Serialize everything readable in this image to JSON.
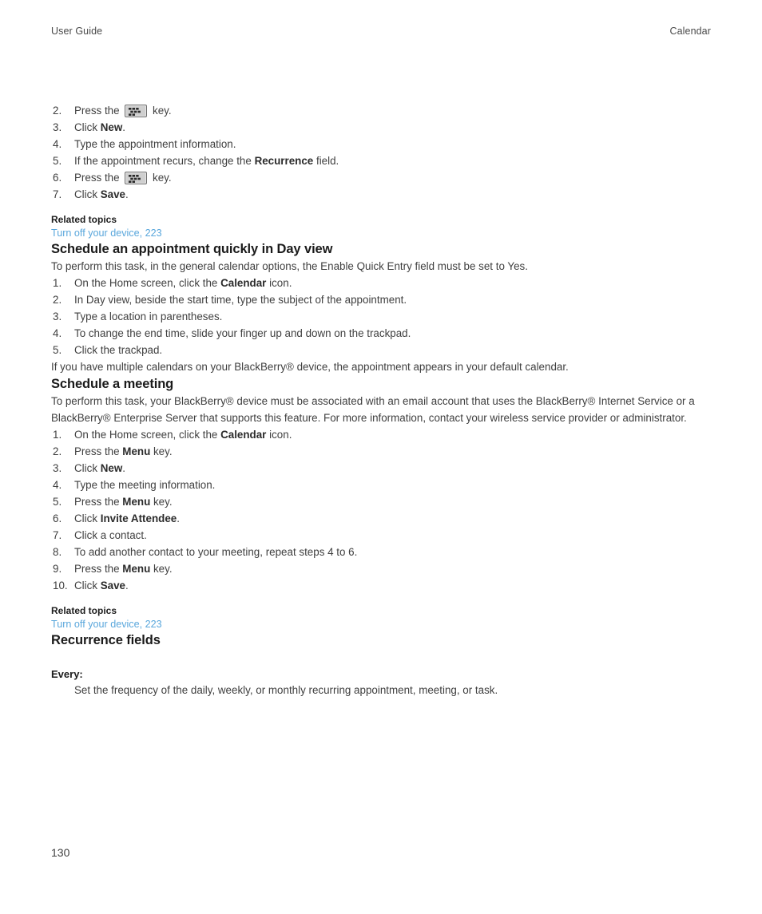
{
  "header": {
    "left": "User Guide",
    "right": "Calendar"
  },
  "icons": {
    "menu_key": "blackberry-menu-key-icon"
  },
  "section_appointment_continued": {
    "steps": [
      {
        "num": "2.",
        "pre": "Press the ",
        "icon": "menu-key",
        "post": " key."
      },
      {
        "num": "3.",
        "pre": "Click ",
        "bold": "New",
        "post": "."
      },
      {
        "num": "4.",
        "pre": "Type the appointment information.",
        "bold": "",
        "post": ""
      },
      {
        "num": "5.",
        "pre": "If the appointment recurs, change the ",
        "bold": "Recurrence",
        "post": " field."
      },
      {
        "num": "6.",
        "pre": "Press the ",
        "icon": "menu-key",
        "post": " key."
      },
      {
        "num": "7.",
        "pre": "Click ",
        "bold": "Save",
        "post": "."
      }
    ],
    "related_label": "Related topics",
    "related_link": "Turn off your device, 223"
  },
  "section_day_view": {
    "heading": "Schedule an appointment quickly in Day view",
    "intro": "To perform this task, in the general calendar options, the Enable Quick Entry field must be set to Yes.",
    "steps": [
      {
        "num": "1.",
        "pre": "On the Home screen, click the ",
        "bold": "Calendar",
        "post": " icon."
      },
      {
        "num": "2.",
        "pre": "In Day view, beside the start time, type the subject of the appointment.",
        "bold": "",
        "post": ""
      },
      {
        "num": "3.",
        "pre": "Type a location in parentheses.",
        "bold": "",
        "post": ""
      },
      {
        "num": "4.",
        "pre": "To change the end time, slide your finger up and down on the trackpad.",
        "bold": "",
        "post": ""
      },
      {
        "num": "5.",
        "pre": "Click the trackpad.",
        "bold": "",
        "post": ""
      }
    ],
    "outro": "If you have multiple calendars on your BlackBerry® device, the appointment appears in your default calendar."
  },
  "section_meeting": {
    "heading": "Schedule a meeting",
    "intro": "To perform this task, your BlackBerry® device must be associated with an email account that uses the BlackBerry® Internet Service or a BlackBerry® Enterprise Server that supports this feature. For more information, contact your wireless service provider or administrator.",
    "steps": [
      {
        "num": "1.",
        "pre": "On the Home screen, click the ",
        "bold": "Calendar",
        "post": " icon."
      },
      {
        "num": "2.",
        "pre": "Press the ",
        "bold": "Menu",
        "post": " key."
      },
      {
        "num": "3.",
        "pre": "Click ",
        "bold": "New",
        "post": "."
      },
      {
        "num": "4.",
        "pre": "Type the meeting information.",
        "bold": "",
        "post": ""
      },
      {
        "num": "5.",
        "pre": "Press the ",
        "bold": "Menu",
        "post": " key."
      },
      {
        "num": "6.",
        "pre": "Click ",
        "bold": "Invite Attendee",
        "post": "."
      },
      {
        "num": "7.",
        "pre": "Click a contact.",
        "bold": "",
        "post": ""
      },
      {
        "num": "8.",
        "pre": "To add another contact to your meeting, repeat steps 4 to 6.",
        "bold": "",
        "post": ""
      },
      {
        "num": "9.",
        "pre": "Press the ",
        "bold": "Menu",
        "post": " key."
      },
      {
        "num": "10.",
        "pre": "Click ",
        "bold": "Save",
        "post": "."
      }
    ],
    "related_label": "Related topics",
    "related_link": "Turn off your device, 223"
  },
  "section_recurrence": {
    "heading": "Recurrence fields",
    "term": "Every:",
    "description": "Set the frequency of the daily, weekly, or monthly recurring appointment, meeting, or task."
  },
  "footer": {
    "page_number": "130"
  },
  "colors": {
    "link": "#5aa7dc",
    "body_text": "#3f3f3f",
    "heading_text": "#1a1a1a",
    "menu_key_face": "#cfcfcf"
  }
}
